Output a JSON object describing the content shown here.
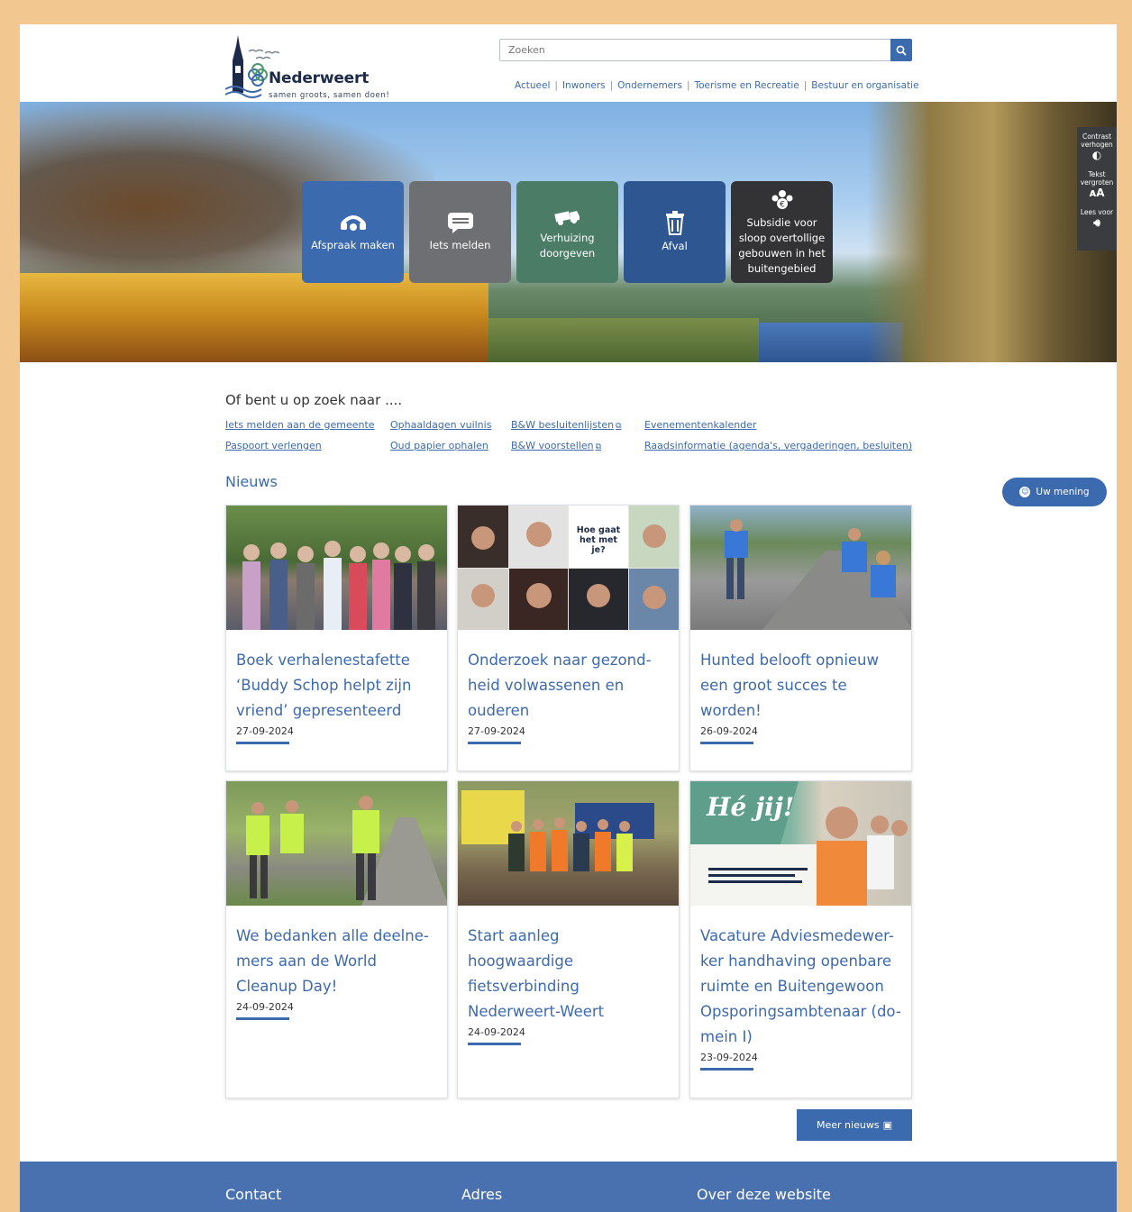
{
  "header": {
    "logo_name": "Nederweert",
    "logo_tagline": "samen groots, samen doen!",
    "search_placeholder": "Zoeken",
    "nav": [
      "Actueel",
      "Inwoners",
      "Ondernemers",
      "Toerisme en Recreatie",
      "Bestuur en organisatie"
    ]
  },
  "hero": {
    "tiles": [
      {
        "label": "Afspraak maken",
        "icon": "phone-icon",
        "color": "#3c6aae"
      },
      {
        "label": "Iets melden",
        "icon": "message-icon",
        "color": "#6e6f73"
      },
      {
        "label": "Verhuizing doorgeven",
        "icon": "moving-truck-icon",
        "color": "#4b7d66"
      },
      {
        "label": "Afval",
        "icon": "trash-icon",
        "color": "#2e5691"
      },
      {
        "label": "Subsidie voor sloop overtollige gebouwen in het buitengebied",
        "icon": "subsidy-icon",
        "color": "#333336"
      }
    ],
    "a11y": {
      "contrast": "Contrast verhogen",
      "text": "Tekst vergroten",
      "read": "Lees voor"
    }
  },
  "suggestions": {
    "title": "Of bent u op zoek naar ....",
    "links": [
      "Iets melden aan de gemeente",
      "Ophaaldagen vuilnis",
      "B&W besluitenlijsten",
      "Evenementenkalender",
      "Paspoort verlengen",
      "Oud papier ophalen",
      "B&W voorstellen",
      "Raadsinformatie (agenda's, vergaderingen, besluiten)"
    ]
  },
  "news": {
    "title": "Nieuws",
    "feedback_label": "Uw mening",
    "image2_caption": "Hoe gaat het met je?",
    "image6_caption": "Hé jij!",
    "items": [
      {
        "title": "Boek verhalenestafette ‘Buddy Schop helpt zijn vriend’ gepresenteerd",
        "date": "27-09-2024"
      },
      {
        "title": "Onderzoek naar gezond-heid volwassenen en ouderen",
        "date": "27-09-2024"
      },
      {
        "title": "Hunted belooft opnieuw een groot succes te worden!",
        "date": "26-09-2024"
      },
      {
        "title": "We bedanken alle deelne-mers aan de World Cleanup Day!",
        "date": "24-09-2024"
      },
      {
        "title": "Start aanleg hoogwaardige fietsverbinding Nederweert-Weert",
        "date": "24-09-2024"
      },
      {
        "title": "Vacature Adviesmedewer-ker handhaving openbare ruimte en Buitengewoon Opsporingsambtenaar (do-mein I)",
        "date": "23-09-2024"
      }
    ],
    "more_label": "Meer nieuws"
  },
  "footer": {
    "cols": [
      "Contact",
      "Adres",
      "Over deze website"
    ]
  }
}
